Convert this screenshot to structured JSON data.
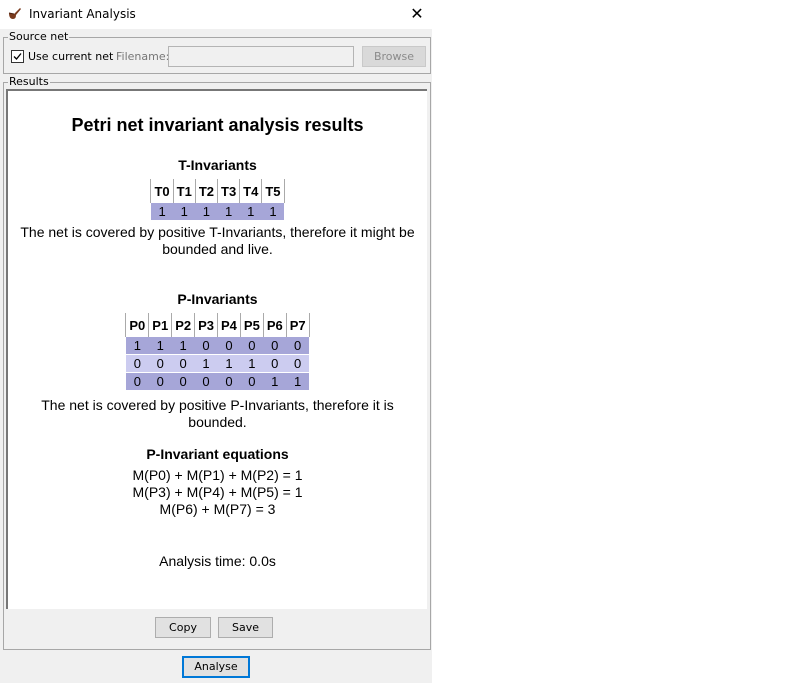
{
  "window": {
    "title": "Invariant Analysis",
    "icon": "pipe-icon",
    "close_glyph": "✕"
  },
  "source": {
    "legend": "Source net",
    "use_current_label": "Use current net",
    "use_current_checked": true,
    "filename_label": "Filename:",
    "filename_value": "",
    "browse_label": "Browse"
  },
  "results": {
    "legend": "Results",
    "heading": "Petri net invariant analysis results",
    "t_invariants": {
      "title": "T-Invariants",
      "headers": [
        "T0",
        "T1",
        "T2",
        "T3",
        "T4",
        "T5"
      ],
      "rows": [
        [
          "1",
          "1",
          "1",
          "1",
          "1",
          "1"
        ]
      ],
      "conclusion": "The net is covered by positive T-Invariants, therefore it might be bounded and live."
    },
    "p_invariants": {
      "title": "P-Invariants",
      "headers": [
        "P0",
        "P1",
        "P2",
        "P3",
        "P4",
        "P5",
        "P6",
        "P7"
      ],
      "rows": [
        [
          "1",
          "1",
          "1",
          "0",
          "0",
          "0",
          "0",
          "0"
        ],
        [
          "0",
          "0",
          "0",
          "1",
          "1",
          "1",
          "0",
          "0"
        ],
        [
          "0",
          "0",
          "0",
          "0",
          "0",
          "0",
          "1",
          "1"
        ]
      ],
      "conclusion": "The net is covered by positive P-Invariants, therefore it is bounded."
    },
    "equations": {
      "title": "P-Invariant equations",
      "lines": [
        "M(P0) + M(P1) + M(P2) = 1",
        "M(P3) + M(P4) + M(P5) = 1",
        "M(P6) + M(P7) = 3"
      ]
    },
    "analysis_time": "Analysis time: 0.0s"
  },
  "buttons": {
    "copy": "Copy",
    "save": "Save",
    "analyse": "Analyse"
  },
  "colors": {
    "row_dark": "#a6a6d8",
    "row_light": "#ccccf0",
    "focus_border": "#0078d7"
  }
}
